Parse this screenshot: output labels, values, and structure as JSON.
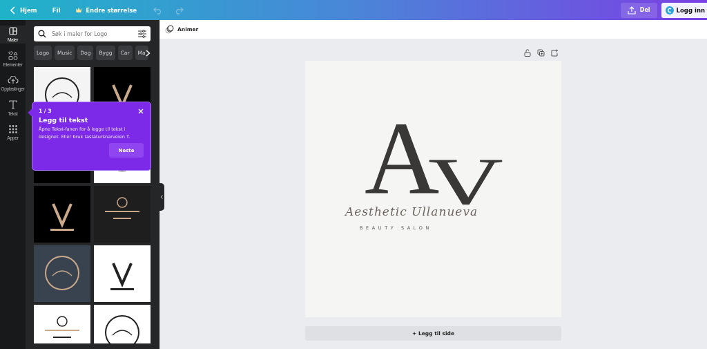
{
  "topbar": {
    "back": "Hjem",
    "file": "Fil",
    "resize": "Endre størrelse",
    "undo_disabled": true,
    "redo_disabled": true,
    "share": "Del",
    "login": "Logg inn"
  },
  "rail": [
    {
      "label": "Maler",
      "selected": true
    },
    {
      "label": "Elementer",
      "selected": false
    },
    {
      "label": "Opplastinger",
      "selected": false
    },
    {
      "label": "Tekst",
      "selected": false
    },
    {
      "label": "Apper",
      "selected": false
    }
  ],
  "search": {
    "placeholder": "Søk i maler for Logo"
  },
  "chips": [
    "Logo",
    "Music",
    "Dog",
    "Bygg",
    "Car",
    "Ma"
  ],
  "tooltip": {
    "step": "1 / 3",
    "title": "Legg til tekst",
    "body": "Åpne Tekst-fanen for å legge til tekst i designet. Eller bruk tastatursnarveien T.",
    "button": "Neste"
  },
  "toolbar": {
    "animate": "Animer"
  },
  "page": {
    "monogram": [
      "A",
      "V"
    ],
    "script": "Aesthetic Ullanueva",
    "tagline": "BEAUTY SALON"
  },
  "add_page": "+ Legg til side"
}
